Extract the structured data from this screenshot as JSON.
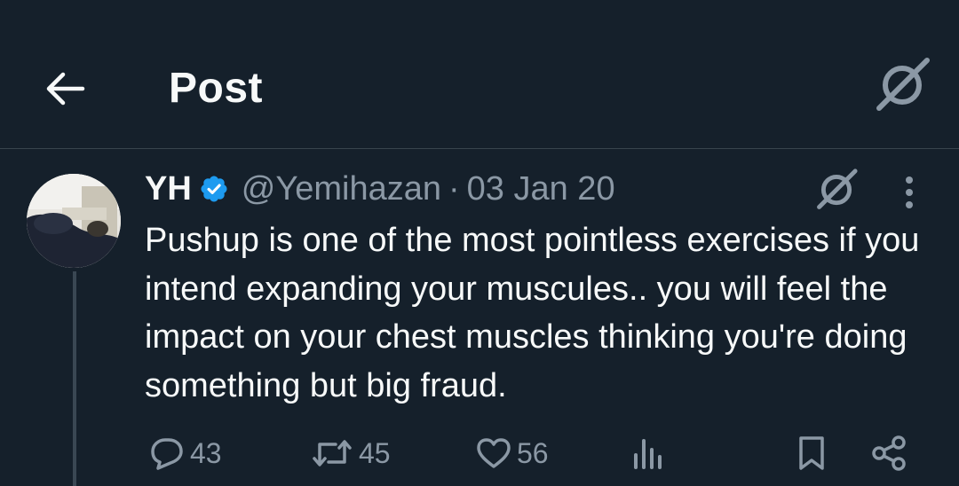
{
  "header": {
    "title": "Post",
    "back_icon": "arrow-left-icon",
    "grok_icon": "grok-icon"
  },
  "tweet": {
    "display_name": "YH",
    "verified": true,
    "handle": "@Yemihazan",
    "separator": "·",
    "date": "03 Jan 20",
    "text": "Pushup is one of the most pointless exercises if you intend expanding your muscules.. you will feel the impact on your chest muscles thinking you're doing something but big fraud.",
    "counts": {
      "replies": "43",
      "reposts": "45",
      "likes": "56"
    }
  },
  "colors": {
    "background": "#15202b",
    "text_primary": "#f7f9f9",
    "text_secondary": "#8b98a5",
    "verified_badge": "#1d9bf0",
    "divider": "#38444d"
  },
  "icons": [
    "arrow-left-icon",
    "grok-icon",
    "verified-badge-icon",
    "more-vertical-icon",
    "reply-icon",
    "repost-icon",
    "like-icon",
    "views-icon",
    "bookmark-icon",
    "share-icon"
  ]
}
